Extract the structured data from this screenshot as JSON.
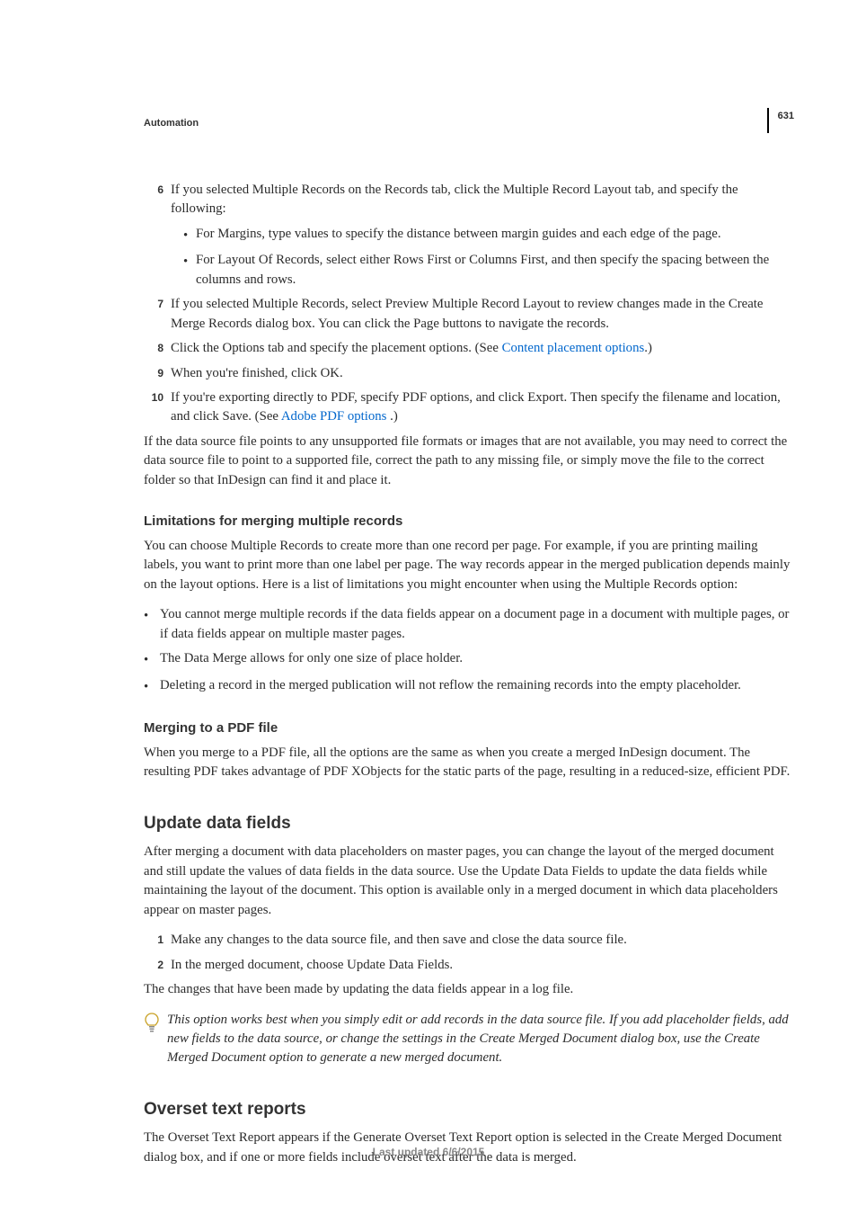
{
  "running_head": "Automation",
  "page_number": "631",
  "steps": {
    "s6": {
      "num": "6",
      "text": "If you selected Multiple Records on the Records tab, click the Multiple Record Layout tab, and specify the following:",
      "bullets": [
        "For Margins, type values to specify the distance between margin guides and each edge of the page.",
        "For Layout Of Records, select either Rows First or Columns First, and then specify the spacing between the columns and rows."
      ]
    },
    "s7": {
      "num": "7",
      "text": "If you selected Multiple Records, select Preview Multiple Record Layout to review changes made in the Create Merge Records dialog box. You can click the Page buttons to navigate the records."
    },
    "s8": {
      "num": "8",
      "pre": "Click the Options tab and specify the placement options. (See ",
      "link": "Content placement options",
      "post": ".)"
    },
    "s9": {
      "num": "9",
      "text": "When you're finished, click OK."
    },
    "s10": {
      "num": "10",
      "pre": "If you're exporting directly to PDF, specify PDF options, and click Export. Then specify the filename and location, and click Save. (See ",
      "link": "Adobe PDF options ",
      "post": ".)"
    }
  },
  "para_after_steps": "If the data source file points to any unsupported file formats or images that are not available, you may need to correct the data source file to point to a supported file, correct the path to any missing file, or simply move the file to the correct folder so that InDesign can find it and place it.",
  "limitations": {
    "heading": "Limitations for merging multiple records",
    "intro": "You can choose Multiple Records to create more than one record per page. For example, if you are printing mailing labels, you want to print more than one label per page. The way records appear in the merged publication depends mainly on the layout options. Here is a list of limitations you might encounter when using the Multiple Records option:",
    "bullets": [
      "You cannot merge multiple records if the data fields appear on a document page in a document with multiple pages, or if data fields appear on multiple master pages.",
      "The Data Merge allows for only one size of place holder.",
      "Deleting a record in the merged publication will not reflow the remaining records into the empty placeholder."
    ]
  },
  "merging_pdf": {
    "heading": "Merging to a PDF file",
    "text": "When you merge to a PDF file, all the options are the same as when you create a merged InDesign document. The resulting PDF takes advantage of PDF XObjects for the static parts of the page, resulting in a reduced-size, efficient PDF."
  },
  "update": {
    "heading": "Update data fields",
    "intro": "After merging a document with data placeholders on master pages, you can change the layout of the merged document and still update the values of data fields in the data source. Use the Update Data Fields to update the data fields while maintaining the layout of the document. This option is available only in a merged document in which data placeholders appear on master pages.",
    "steps": [
      {
        "num": "1",
        "text": "Make any changes to the data source file, and then save and close the data source file."
      },
      {
        "num": "2",
        "text": "In the merged document, choose Update Data Fields."
      }
    ],
    "after": "The changes that have been made by updating the data fields appear in a log file.",
    "tip": "This option works best when you simply edit or add records in the data source file. If you add placeholder fields, add new fields to the data source, or change the settings in the Create Merged Document dialog box, use the Create Merged Document option to generate a new merged document."
  },
  "overset": {
    "heading": "Overset text reports",
    "text": "The Overset Text Report appears if the Generate Overset Text Report option is selected in the Create Merged Document dialog box, and if one or more fields include overset text after the data is merged."
  },
  "footer": "Last updated 6/6/2015"
}
